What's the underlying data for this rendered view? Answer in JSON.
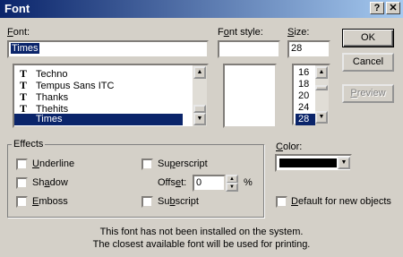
{
  "window": {
    "title": "Font",
    "help_btn": "?",
    "close_btn": "✕"
  },
  "font": {
    "label": "Font:",
    "value": "Times",
    "items": [
      "Techno",
      "Tempus Sans ITC",
      "Thanks",
      "Thehits",
      "Times"
    ],
    "selected": "Times"
  },
  "style": {
    "label": "Font style:",
    "value": ""
  },
  "size": {
    "label": "Size:",
    "value": "28",
    "items": [
      "16",
      "18",
      "20",
      "24",
      "28"
    ],
    "selected": "28"
  },
  "buttons": {
    "ok": "OK",
    "cancel": "Cancel",
    "preview": "Preview"
  },
  "effects": {
    "label": "Effects",
    "underline": "Underline",
    "shadow": "Shadow",
    "emboss": "Emboss",
    "superscript": "Superscript",
    "subscript": "Subscript",
    "offset_label": "Offset:",
    "offset_value": "0",
    "percent": "%"
  },
  "color": {
    "label": "Color:",
    "value": "#000000"
  },
  "default_checkbox": "Default for new objects",
  "message": {
    "line1": "This font has not been installed on the system.",
    "line2": "The closest available font will be used for printing."
  },
  "icons": {
    "font_type": "truetype-icon",
    "scroll_up": "up-arrow-icon",
    "scroll_down": "down-arrow-icon"
  }
}
